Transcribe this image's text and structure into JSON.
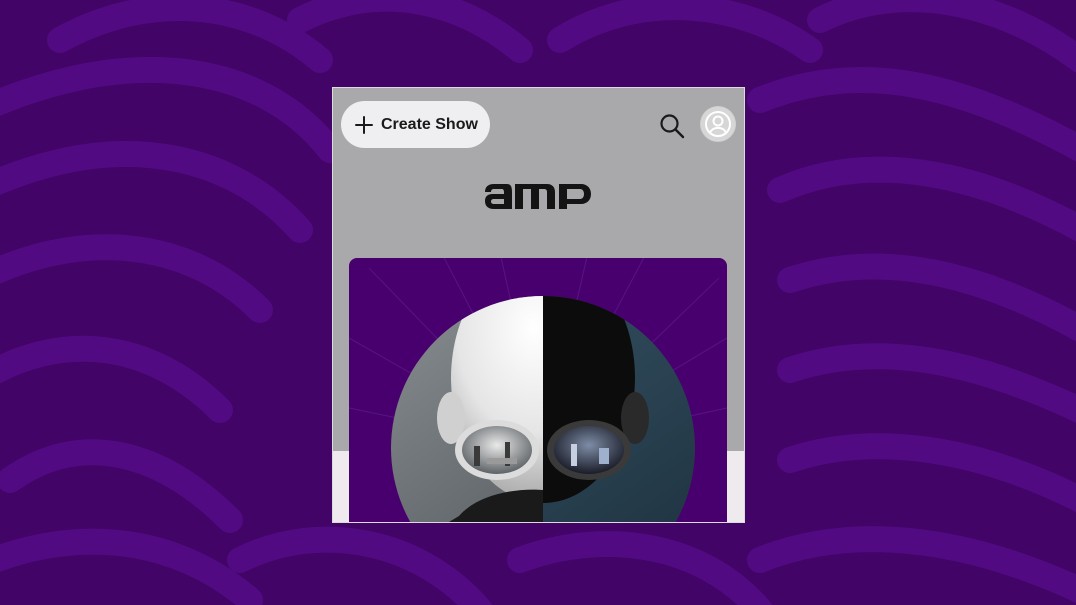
{
  "header": {
    "create_label": "Create Show",
    "search_icon": "search-icon",
    "avatar_icon": "user-avatar-icon"
  },
  "brand": {
    "logo_text": "amp"
  },
  "show_card": {
    "image": "bald-man-mirrored-sunglasses-split-portrait"
  },
  "colors": {
    "background": "#420466",
    "background_swirl": "#520a82",
    "app_bar": "#a9a8aa",
    "button_bg": "#efeef0",
    "card_bg": "#47006d",
    "content_bg": "#eeeaee"
  }
}
